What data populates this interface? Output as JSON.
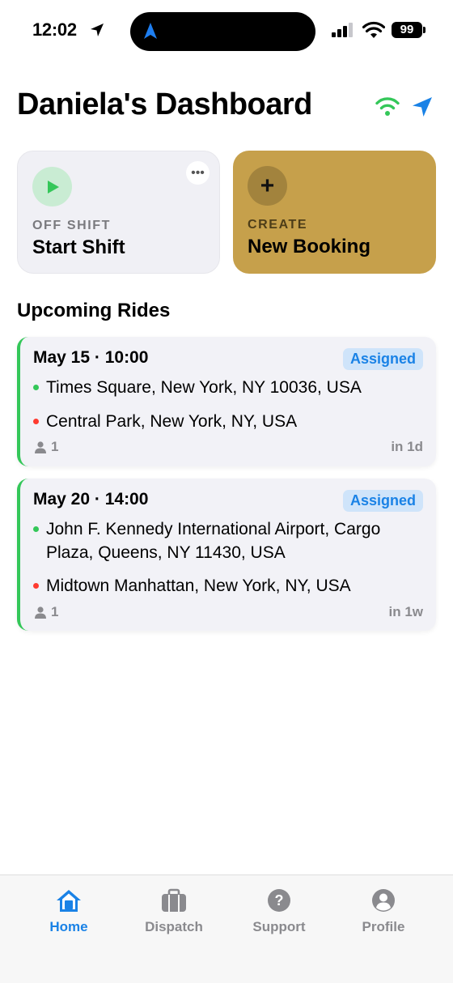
{
  "status_bar": {
    "time": "12:02",
    "battery": "99"
  },
  "header": {
    "title": "Daniela's Dashboard"
  },
  "cards": {
    "shift": {
      "eyebrow": "OFF SHIFT",
      "title": "Start Shift",
      "more": "•••"
    },
    "booking": {
      "eyebrow": "CREATE",
      "title": "New Booking",
      "plus": "+"
    }
  },
  "upcoming": {
    "title": "Upcoming Rides",
    "rides": [
      {
        "when": "May 15 · 10:00",
        "status": "Assigned",
        "pickup": "Times Square, New York, NY 10036, USA",
        "dropoff": "Central Park, New York, NY, USA",
        "passengers": "1",
        "eta": "in 1d"
      },
      {
        "when": "May 20 · 14:00",
        "status": "Assigned",
        "pickup": "John F. Kennedy International Airport, Cargo Plaza, Queens, NY 11430, USA",
        "dropoff": "Midtown Manhattan, New York, NY, USA",
        "passengers": "1",
        "eta": "in 1w"
      }
    ]
  },
  "tabs": [
    {
      "label": "Home",
      "icon": "home-icon",
      "active": true
    },
    {
      "label": "Dispatch",
      "icon": "briefcase-icon",
      "active": false
    },
    {
      "label": "Support",
      "icon": "question-icon",
      "active": false
    },
    {
      "label": "Profile",
      "icon": "person-icon",
      "active": false
    }
  ],
  "colors": {
    "accent": "#1a82e6",
    "booking_card": "#c6a04b",
    "ride_border": "#34c759",
    "pickup_dot": "#34c759",
    "dropoff_dot": "#ff3b30",
    "badge_bg": "#cfe4fa"
  }
}
